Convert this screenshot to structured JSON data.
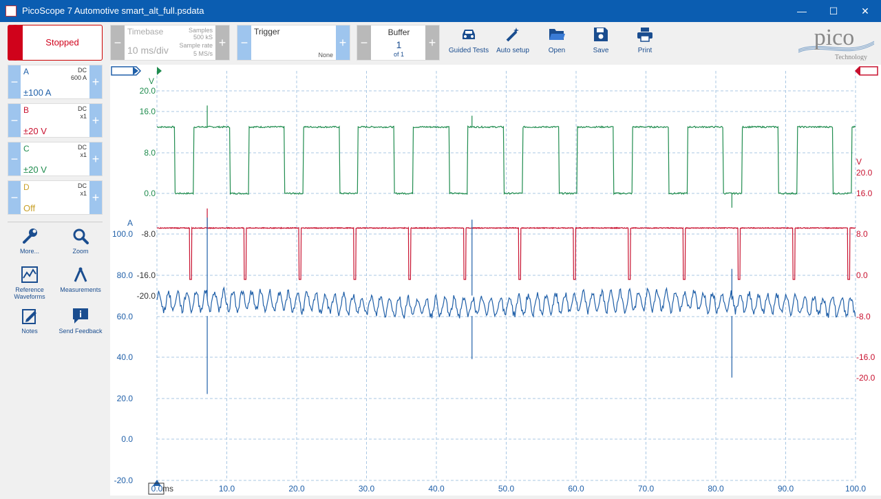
{
  "window": {
    "title": "PicoScope 7 Automotive smart_alt_full.psdata",
    "minimize": "—",
    "maximize": "☐",
    "close": "✕"
  },
  "toolbar": {
    "run_state": "Stopped",
    "timebase_label": "Timebase",
    "timebase_value": "10 ms/div",
    "samples_label": "Samples",
    "samples_value": "500 kS",
    "sample_rate_label": "Sample rate",
    "sample_rate_value": "5 MS/s",
    "trigger_label": "Trigger",
    "trigger_value": "None",
    "buffer_label": "Buffer",
    "buffer_value": "1",
    "buffer_of": "of 1",
    "minus": "−",
    "plus": "+",
    "buttons": {
      "guided": "Guided Tests",
      "autosetup": "Auto setup",
      "open": "Open",
      "save": "Save",
      "print": "Print"
    },
    "logo_text": "pico",
    "logo_sub": "Technology"
  },
  "channels": [
    {
      "name": "A",
      "coupling": "DC",
      "probe": "600 A",
      "range": "±100 A",
      "color": "#1f5fa8"
    },
    {
      "name": "B",
      "coupling": "DC",
      "probe": "x1",
      "range": "±20 V",
      "color": "#c8102e"
    },
    {
      "name": "C",
      "coupling": "DC",
      "probe": "x1",
      "range": "±20 V",
      "color": "#1f8c4e"
    },
    {
      "name": "D",
      "coupling": "DC",
      "probe": "x1",
      "range": "Off",
      "color": "#c8a028"
    }
  ],
  "tools": {
    "more": "More...",
    "zoom": "Zoom",
    "reference": "Reference\nWaveforms",
    "reference_line1": "Reference",
    "reference_line2": "Waveforms",
    "measurements": "Measurements",
    "notes": "Notes",
    "feedback": "Send Feedback"
  },
  "chart_data": {
    "type": "line",
    "xlabel": "ms",
    "x_ticks": [
      "0.0",
      "10.0",
      "20.0",
      "30.0",
      "40.0",
      "50.0",
      "60.0",
      "70.0",
      "80.0",
      "90.0",
      "100.0"
    ],
    "xlim": [
      0,
      100
    ],
    "channel_A": {
      "unit": "A",
      "ticks": [
        "100.0",
        "80.0",
        "60.0",
        "40.0",
        "20.0",
        "0.0",
        "-20.0"
      ],
      "color": "#1f5fa8"
    },
    "channel_C": {
      "unit": "V",
      "ticks": [
        "20.0",
        "16.0",
        "8.0",
        "0.0",
        "-8.0",
        "-16.0",
        "-20.0"
      ],
      "color": "#1f8c4e"
    },
    "channel_B": {
      "unit": "V",
      "ticks": [
        "20.0",
        "16.0",
        "8.0",
        "0.0",
        "-8.0",
        "-16.0",
        "-20.0"
      ],
      "color": "#c8102e"
    },
    "grid": true,
    "square_wave": {
      "high_V": 13,
      "low_V": 0,
      "period_ms": 7.85,
      "duty": 0.66
    },
    "pulse_wave": {
      "base_V": 9.2,
      "dip_V": -0.8,
      "period_ms": 7.85
    },
    "current_ripple": {
      "mean_A": 65,
      "amplitude_A": 4.5
    }
  }
}
